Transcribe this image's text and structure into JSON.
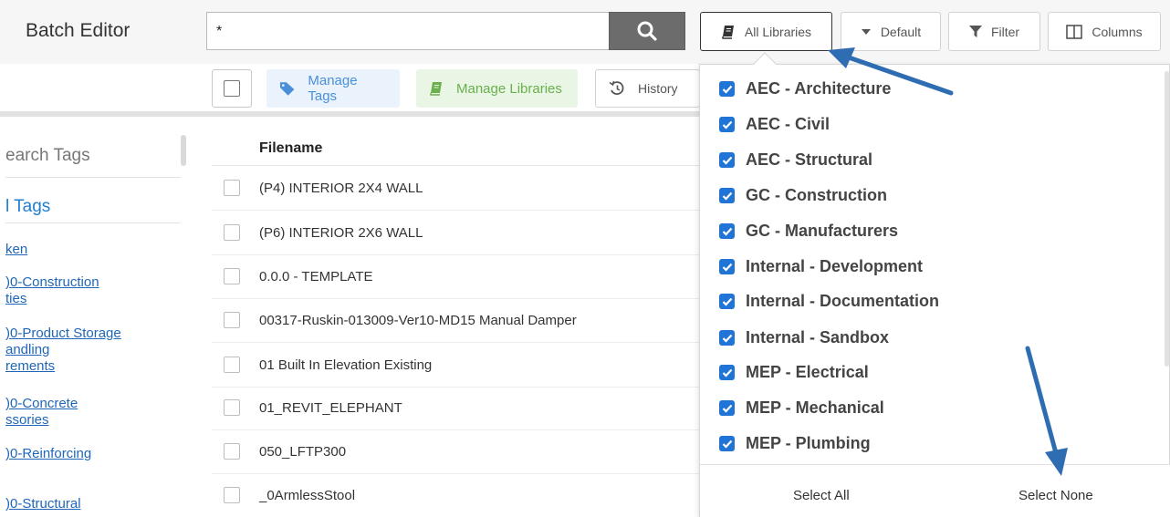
{
  "header": {
    "app_title": "Batch Editor",
    "search_value": "*",
    "all_libraries_label": "All Libraries",
    "default_label": "Default",
    "filter_label": "Filter",
    "columns_label": "Columns"
  },
  "toolbar": {
    "manage_tags_label": "Manage Tags",
    "manage_libraries_label": "Manage Libraries",
    "history_label": "History"
  },
  "sidebar": {
    "search_placeholder": "earch Tags",
    "all_tags_label": "l Tags",
    "links": [
      "ken",
      ")0-Construction\nties",
      ")0-Product Storage\nandling\nrements",
      ")0-Concrete\nssories",
      ")0-Reinforcing",
      ")0-Structural"
    ]
  },
  "table": {
    "header": "Filename",
    "rows": [
      "(P4) INTERIOR 2X4 WALL",
      "(P6) INTERIOR 2X6 WALL",
      "0.0.0 - TEMPLATE",
      "00317-Ruskin-013009-Ver10-MD15 Manual Damper",
      "01 Built In Elevation Existing",
      "01_REVIT_ELEPHANT",
      "050_LFTP300",
      "_0ArmlessStool"
    ]
  },
  "libraries_dropdown": {
    "items": [
      {
        "label": "AEC - Architecture",
        "checked": true
      },
      {
        "label": "AEC - Civil",
        "checked": true
      },
      {
        "label": "AEC - Structural",
        "checked": true
      },
      {
        "label": "GC - Construction",
        "checked": true
      },
      {
        "label": "GC - Manufacturers",
        "checked": true
      },
      {
        "label": "Internal - Development",
        "checked": true
      },
      {
        "label": "Internal - Documentation",
        "checked": true
      },
      {
        "label": "Internal - Sandbox",
        "checked": true
      },
      {
        "label": "MEP - Electrical",
        "checked": true
      },
      {
        "label": "MEP - Mechanical",
        "checked": true
      },
      {
        "label": "MEP - Plumbing",
        "checked": true
      }
    ],
    "select_all_label": "Select All",
    "select_none_label": "Select None"
  },
  "colors": {
    "accent_blue": "#1f74d6",
    "arrow_blue": "#2f6db3",
    "tag_blue": "#4a90d9",
    "library_green": "#6ab04c",
    "search_button": "#6c6c6c"
  },
  "icons": {
    "search": "search-icon",
    "book": "book-icon",
    "caret_down": "caret-down-icon",
    "filter": "filter-icon",
    "columns": "columns-icon",
    "tag": "tag-icon",
    "history": "history-icon",
    "check": "check-icon"
  }
}
